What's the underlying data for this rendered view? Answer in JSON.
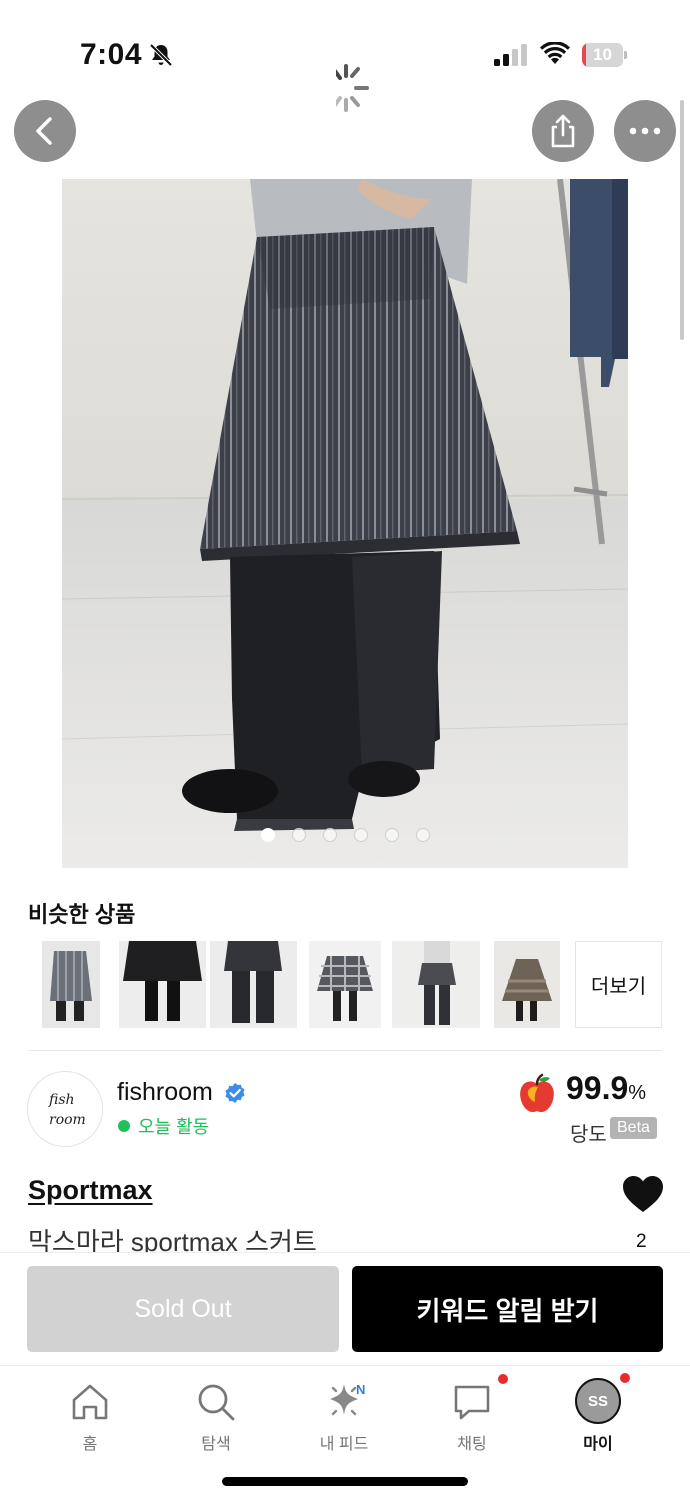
{
  "status_bar": {
    "time": "7:04",
    "battery_level": "10",
    "battery_fraction": 0.1,
    "icons": [
      "bell-slash-icon",
      "signal-icon",
      "wifi-icon",
      "battery-icon"
    ]
  },
  "header": {
    "icons": [
      "chevron-left-icon",
      "share-icon",
      "ellipsis-icon",
      "loading-spinner-icon"
    ]
  },
  "gallery": {
    "image_count": 6,
    "active_index": 0
  },
  "similar": {
    "title": "비슷한 상품",
    "more_label": "더보기",
    "thumbnail_count": 6
  },
  "seller": {
    "logo_text_line1": "fish",
    "logo_text_line2": "room",
    "name": "fishroom",
    "status": "오늘 활동",
    "score_value": "99.9",
    "score_unit": "%",
    "score_label": "당도",
    "score_badge": "Beta",
    "colors": {
      "online": "#1fbf5a",
      "verified": "#3b8de8",
      "apple": "#e53a2f"
    }
  },
  "product": {
    "brand": "Sportmax",
    "name": "막스마라 sportmax 스커트",
    "like_count": "2"
  },
  "actions": {
    "sold_out_label": "Sold Out",
    "keyword_alert_label": "키워드 알림 받기"
  },
  "tabbar": {
    "items": [
      {
        "label": "홈",
        "icon": "home-icon"
      },
      {
        "label": "탐색",
        "icon": "search-icon"
      },
      {
        "label": "내 피드",
        "icon": "sparkle-icon",
        "badge": "N"
      },
      {
        "label": "채팅",
        "icon": "chat-icon"
      },
      {
        "label": "마이",
        "icon": "avatar",
        "avatar_initials": "SS"
      }
    ]
  }
}
